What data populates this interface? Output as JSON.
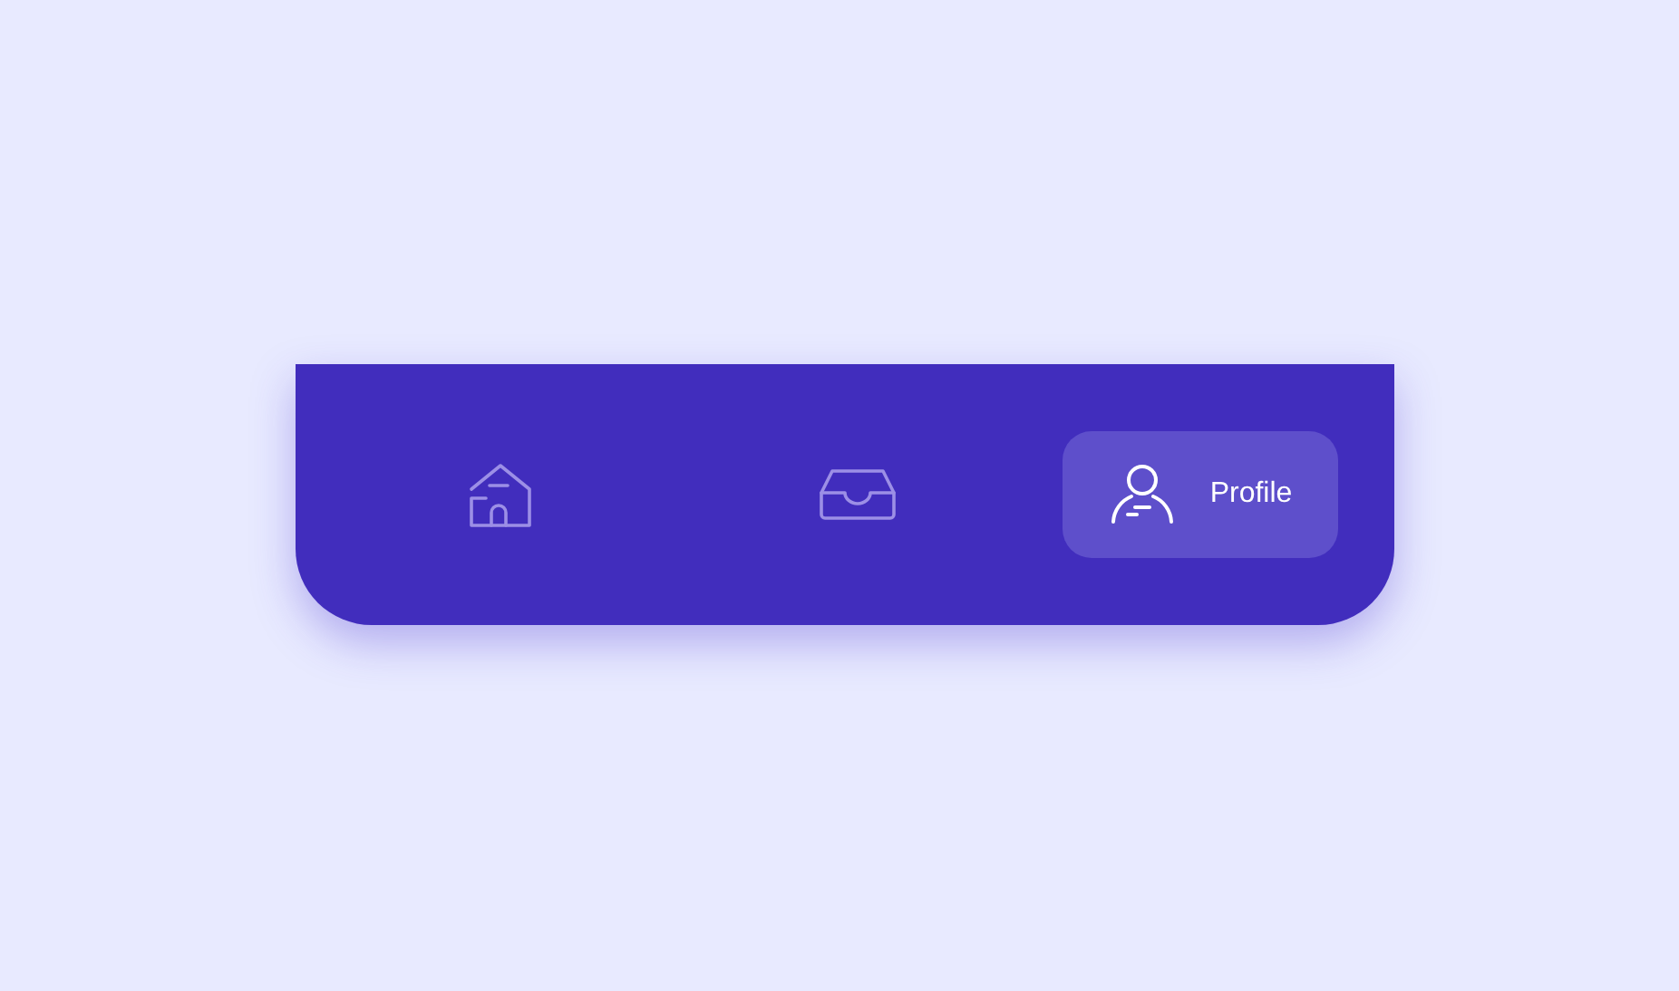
{
  "nav_bar": {
    "items": [
      {
        "selected": false
      },
      {
        "selected": false
      },
      {
        "selected": true,
        "label": "Profile"
      }
    ]
  }
}
